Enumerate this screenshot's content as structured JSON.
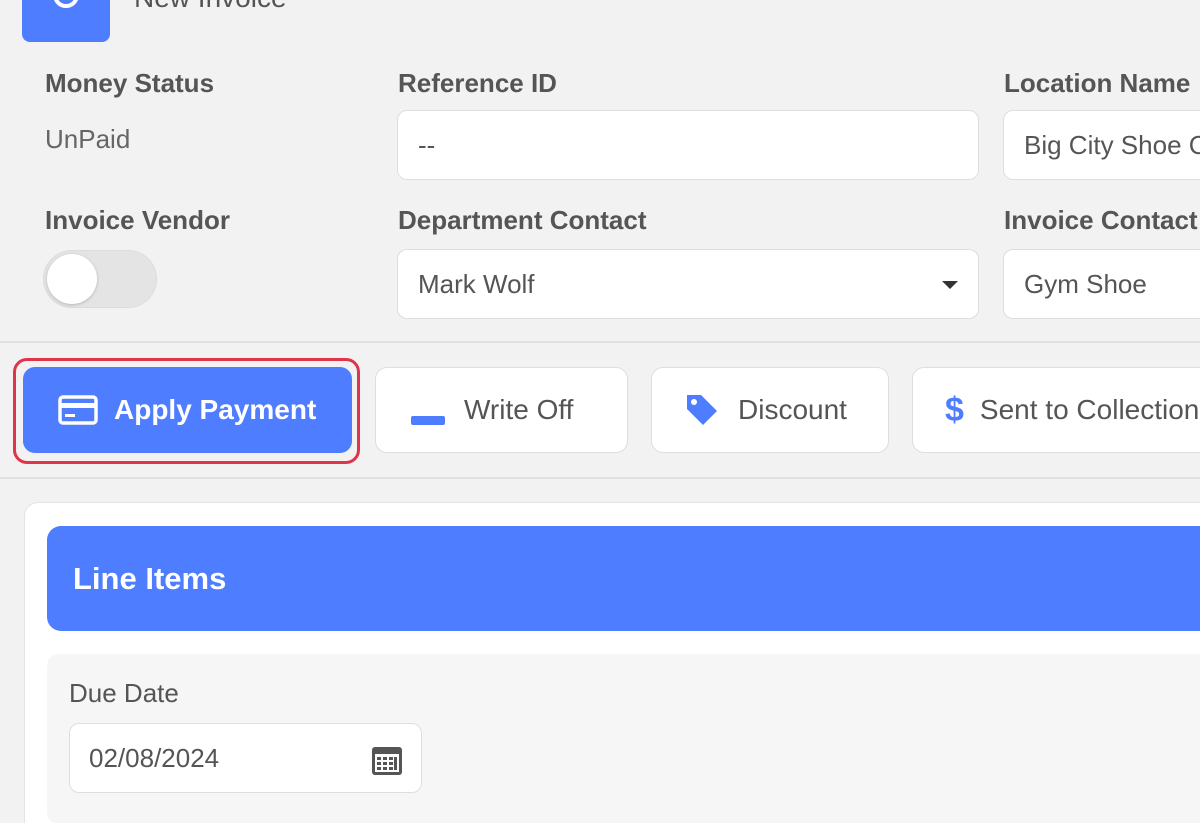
{
  "header": {
    "title": "New Invoice"
  },
  "fields": {
    "money_status_label": "Money Status",
    "money_status_value": "UnPaid",
    "reference_id_label": "Reference ID",
    "reference_id_value": "--",
    "location_name_label": "Location Name",
    "location_name_value": "Big City Shoe Co",
    "invoice_vendor_label": "Invoice Vendor",
    "department_contact_label": "Department Contact",
    "department_contact_value": "Mark Wolf",
    "invoice_contact_label": "Invoice Contact",
    "invoice_contact_value": "Gym Shoe"
  },
  "toggle": {
    "invoice_vendor_on": false
  },
  "actions": {
    "apply_payment": "Apply Payment",
    "write_off": "Write Off",
    "discount": "Discount",
    "sent_to_collections": "Sent to Collections"
  },
  "line_items": {
    "title": "Line Items",
    "due_date_label": "Due Date",
    "due_date_value": "02/08/2024"
  },
  "colors": {
    "accent": "#4f7dff",
    "highlight": "#e0344a",
    "background": "#f2f2f2"
  },
  "icons": {
    "header": "circle-icon",
    "apply_payment": "credit-card-icon",
    "write_off": "minus-icon",
    "discount": "tag-icon",
    "sent_to_collections": "dollar-icon",
    "due_date": "calendar-icon"
  }
}
